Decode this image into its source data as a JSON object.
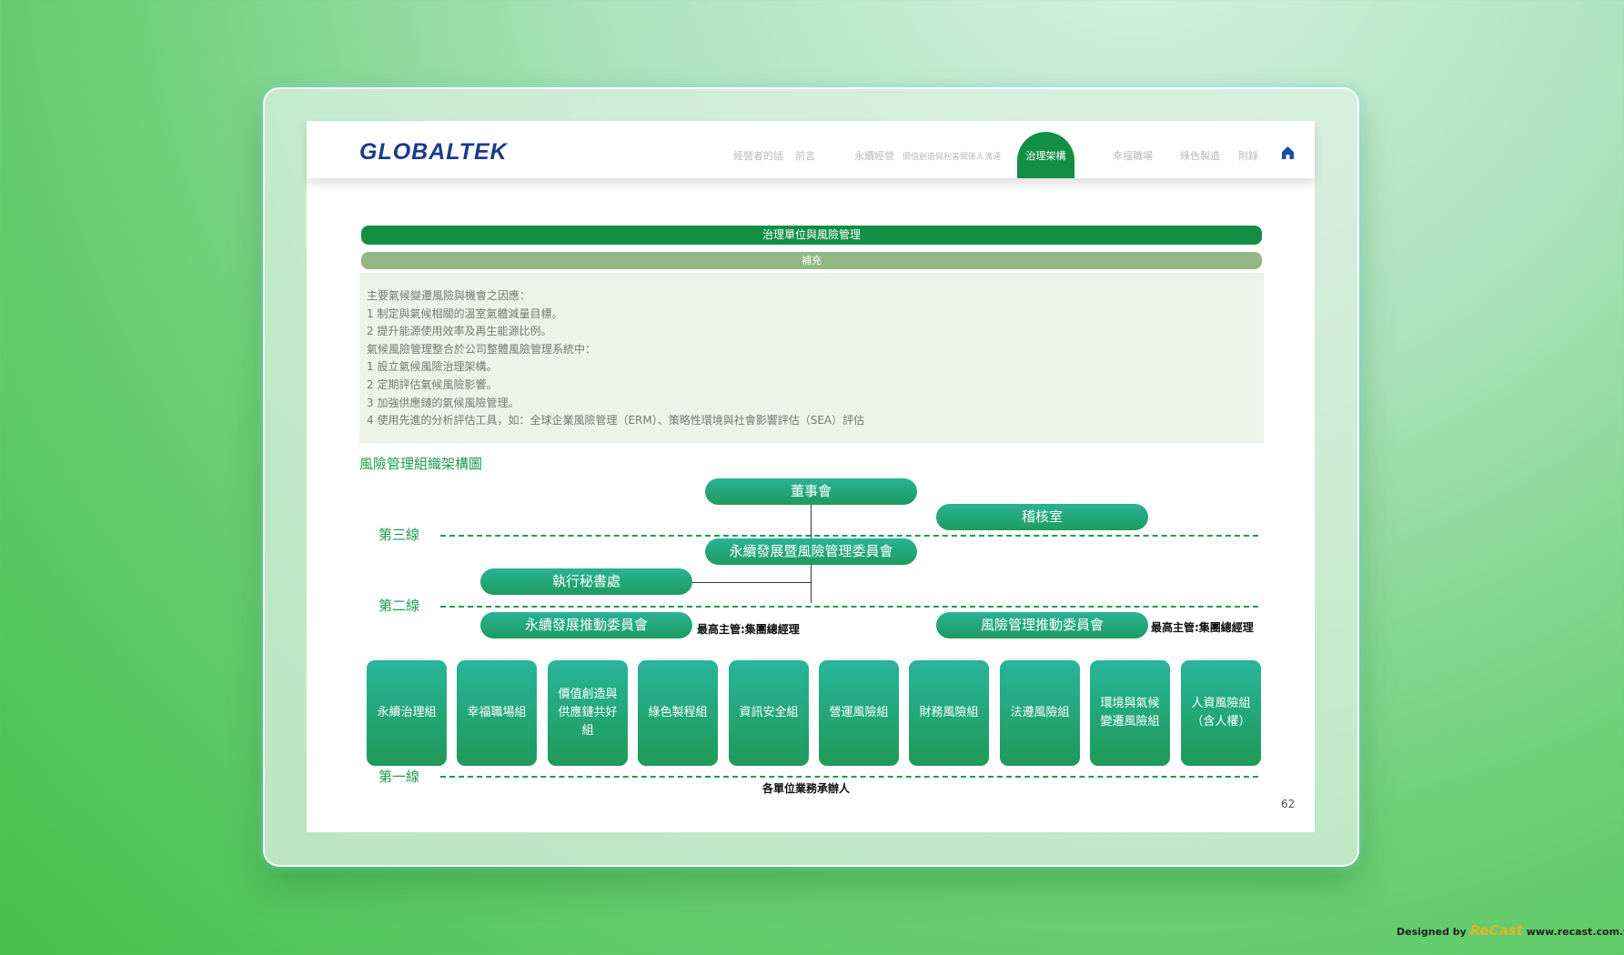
{
  "nav": {
    "logo": "GLOBALTEK",
    "items": [
      "經營者的話",
      "前言",
      "永續經營",
      "價值創造與利害關係人溝通",
      "治理架構",
      "幸福職場",
      "綠色製造",
      "附錄"
    ],
    "active_index": 4,
    "home_icon": "home-icon"
  },
  "section": {
    "title": "治理單位與風險管理",
    "subtitle": "補充",
    "lines": [
      "主要氣候變遷風險與機會之因應：",
      "1 制定與氣候相關的溫室氣體減量目標。",
      "2 提升能源使用效率及再生能源比例。",
      "氣候風險管理整合於公司整體風險管理系統中：",
      "1 設立氣候風險治理架構。",
      "2 定期評估氣候風險影響。",
      "3 加強供應鏈的氣候風險管理。",
      "4 使用先進的分析評估工具，如：全球企業風險管理（ERM）、策略性環境與社會影響評估（SEA）評估"
    ]
  },
  "org": {
    "title": "風險管理組織架構圖",
    "board": "董事會",
    "audit": "稽核室",
    "committee": "永續發展暨風險管理委員會",
    "secretariat": "執行秘書處",
    "sd_committee": "永續發展推動委員會",
    "risk_committee": "風險管理推動委員會",
    "head_note_left": "最高主管:集團總經理",
    "head_note_right": "最高主管:集團總經理",
    "line3": "第三線",
    "line2": "第二線",
    "line1": "第一線",
    "groups": [
      "永續治理組",
      "幸福職場組",
      "價值創造與供應鏈共好組",
      "綠色製程組",
      "資訊安全組",
      "營運風險組",
      "財務風險組",
      "法遵風險組",
      "環境與氣候變遷風險組",
      "人資風險組（含人權）"
    ],
    "bottom_note": "各單位業務承辦人"
  },
  "page_number": "62",
  "credit": {
    "prefix": "Designed by",
    "brand": "ReCast",
    "url": "www.recast.com.tw"
  },
  "colors": {
    "primary_green": "#138f45",
    "sub_green": "#93b782",
    "logo_blue": "#1a3a8c"
  }
}
